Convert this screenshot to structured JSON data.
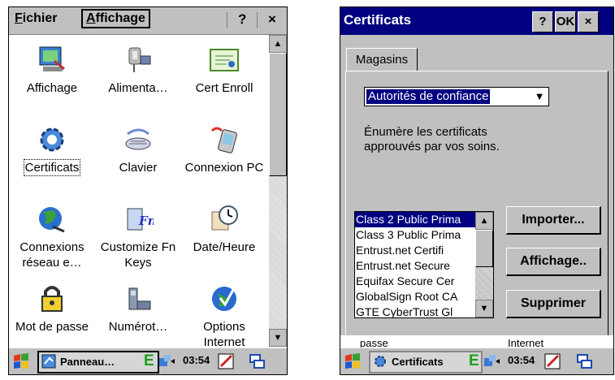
{
  "left": {
    "menu": {
      "file": "Fichier",
      "file_underline": "F",
      "file_rest": "ichier",
      "view_underline": "A",
      "view_rest": "ffichage",
      "help": "?",
      "close": "×"
    },
    "icons": [
      {
        "label": "Affichage",
        "icon": "display-icon"
      },
      {
        "label": "Alimenta…",
        "icon": "power-icon"
      },
      {
        "label": "Cert Enroll",
        "icon": "certificate-enroll-icon"
      },
      {
        "label": "Certificats",
        "icon": "certificates-icon"
      },
      {
        "label": "Clavier",
        "icon": "keyboard-icon"
      },
      {
        "label": "Connexion PC",
        "icon": "pc-connection-icon"
      },
      {
        "label": "Connexions réseau e…",
        "icon": "network-globe-icon"
      },
      {
        "label": "Customize Fn Keys",
        "icon": "fn-keys-icon"
      },
      {
        "label": "Date/Heure",
        "icon": "clock-icon"
      },
      {
        "label": "Mot de passe",
        "icon": "padlock-icon"
      },
      {
        "label": "Numérot…",
        "icon": "phone-icon"
      },
      {
        "label": "Options Internet",
        "icon": "internet-options-icon"
      }
    ],
    "taskbar": {
      "app": "Panneau…",
      "network": "E",
      "time": "03:54"
    }
  },
  "right": {
    "title": "Certificats",
    "buttons": {
      "help": "?",
      "ok": "OK",
      "close": "×"
    },
    "tab": "Magasins",
    "store": "Autorités de confiance",
    "description": "Énumère les certificats approuvés par vos soins.",
    "certificates": [
      "Class 2 Public Prima",
      "Class 3 Public Prima",
      "Entrust.net Certifi",
      "Entrust.net Secure",
      "Equifax Secure Cer",
      "GlobalSign Root CA",
      "GTE CyberTrust Gl"
    ],
    "actions": {
      "import": "Importer...",
      "view": "Affichage..",
      "delete": "Supprimer"
    },
    "background_labels": {
      "left": "passe",
      "right": "Internet"
    },
    "taskbar": {
      "app": "Certificats",
      "network": "E",
      "time": "03:54"
    }
  },
  "colors": {
    "titlebar": "#000080",
    "chrome": "#c0c0c0",
    "network_e": "#18a018"
  }
}
